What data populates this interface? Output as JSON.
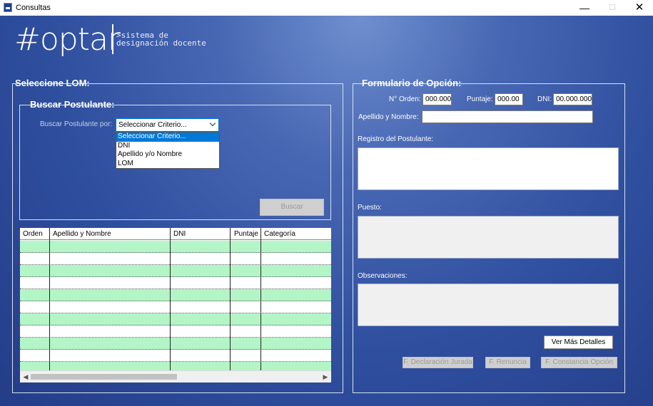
{
  "window": {
    "title": "Consultas",
    "minimize": "—",
    "maximize": "☐",
    "close": "✕"
  },
  "logo": {
    "main": "#optar",
    "subtitle": ">sistema de\ndesignación docente"
  },
  "lom_group": {
    "title": "Seleccione LOM:"
  },
  "search_group": {
    "title": "Buscar Postulante:",
    "criteria_label": "Buscar Postulante por:",
    "selected": "Seleccionar Criterio...",
    "options": [
      "Seleccionar Criterio...",
      "DNI",
      "Apellido y/o Nombre",
      "LOM"
    ],
    "search_button": "Buscar"
  },
  "grid": {
    "columns": [
      "Orden",
      "Apellido y Nombre",
      "DNI",
      "Puntaje",
      "Categoría"
    ],
    "row_count": 11
  },
  "form": {
    "title": "Formulario de Opción:",
    "orden_label": "N° Orden:",
    "orden_value": "000.000",
    "puntaje_label": "Puntaje:",
    "puntaje_value": "000.00",
    "dni_label": "DNI:",
    "dni_value": "00.000.000",
    "nombre_label": "Apellido y Nombre:",
    "nombre_value": "",
    "registro_label": "Registro del Postulante:",
    "puesto_label": "Puesto:",
    "observaciones_label": "Observaciones:",
    "details_button": "Ver Más Detalles",
    "declaracion_button": "F. Declaración Jurada",
    "renuncia_button": "F. Renuncia",
    "constancia_button": "F. Constancia Opción"
  },
  "colors": {
    "accent": "#0078d7",
    "row_alt": "#b3f5c6",
    "bg_dark": "#233d88",
    "bg_light": "#6f8fcf"
  }
}
